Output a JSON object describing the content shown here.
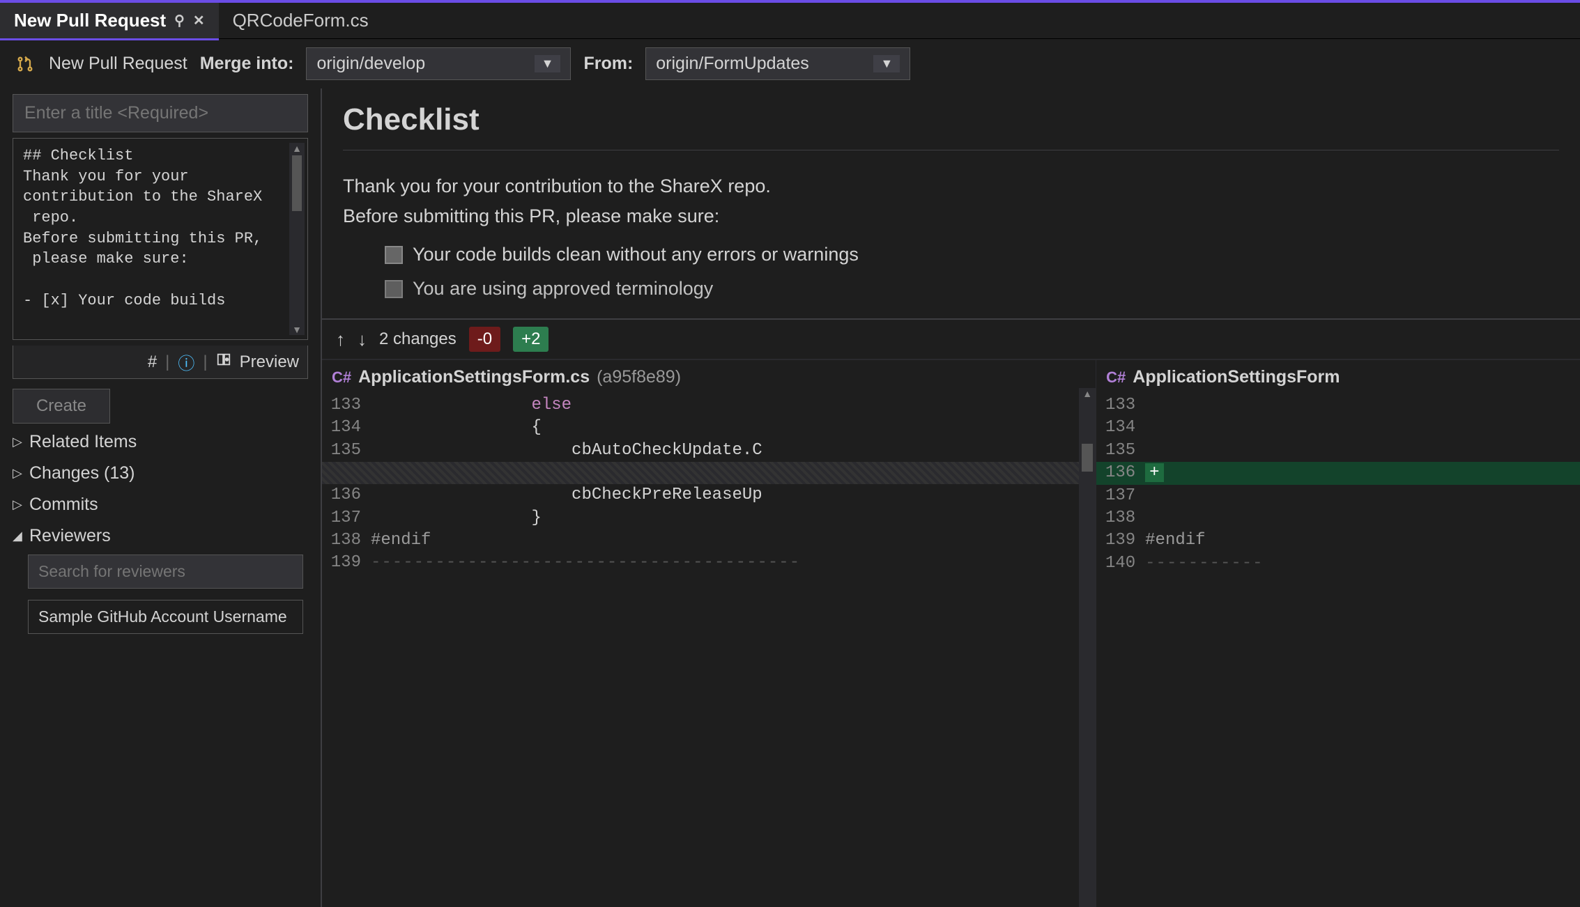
{
  "tabs": {
    "active": "New Pull Request",
    "inactive": "QRCodeForm.cs"
  },
  "toolbar": {
    "title": "New Pull Request",
    "merge_into_label": "Merge into:",
    "merge_into_value": "origin/develop",
    "from_label": "From:",
    "from_value": "origin/FormUpdates"
  },
  "form": {
    "title_placeholder": "Enter a title <Required>",
    "description": "## Checklist\nThank you for your\ncontribution to the ShareX\n repo.\nBefore submitting this PR,\n please make sure:\n\n- [x] Your code builds",
    "hash_icon": "#",
    "preview_label": "Preview",
    "create_label": "Create"
  },
  "tree": {
    "related": "Related Items",
    "changes": "Changes (13)",
    "commits": "Commits",
    "reviewers": "Reviewers",
    "search_placeholder": "Search for reviewers",
    "reviewer1": "Sample GitHub Account Username"
  },
  "preview": {
    "heading": "Checklist",
    "p1": "Thank you for your contribution to the ShareX repo.",
    "p2": "Before submitting this PR, please make sure:",
    "item1": "Your code builds clean without any errors or warnings",
    "item2": "You are using approved terminology"
  },
  "diff": {
    "changes_label": "2 changes",
    "minus": "-0",
    "plus": "+2",
    "file_left": "ApplicationSettingsForm.cs",
    "hash_left": "(a95f8e89)",
    "file_right": "ApplicationSettingsForm",
    "left_lines": [
      {
        "num": "133",
        "content": "                else",
        "cls": "kw"
      },
      {
        "num": "134",
        "content": "                {",
        "cls": "brace"
      },
      {
        "num": "135",
        "content": "                    cbAutoCheckUpdate.C",
        "cls": ""
      },
      {
        "num": "",
        "content": "",
        "cls": "hatched"
      },
      {
        "num": "136",
        "content": "                    cbCheckPreReleaseUp",
        "cls": ""
      },
      {
        "num": "137",
        "content": "                }",
        "cls": "brace"
      },
      {
        "num": "138",
        "content": "#endif",
        "cls": "preproc"
      },
      {
        "num": "139",
        "content": "----------------------------------------",
        "cls": "dashed"
      }
    ],
    "right_lines": [
      {
        "num": "133",
        "content": "",
        "cls": ""
      },
      {
        "num": "134",
        "content": "",
        "cls": ""
      },
      {
        "num": "135",
        "content": "",
        "cls": ""
      },
      {
        "num": "136",
        "content": "+",
        "cls": "added"
      },
      {
        "num": "137",
        "content": "",
        "cls": ""
      },
      {
        "num": "138",
        "content": "",
        "cls": ""
      },
      {
        "num": "139",
        "content": "#endif",
        "cls": "preproc"
      },
      {
        "num": "140",
        "content": "-----------",
        "cls": "dashed"
      }
    ]
  }
}
